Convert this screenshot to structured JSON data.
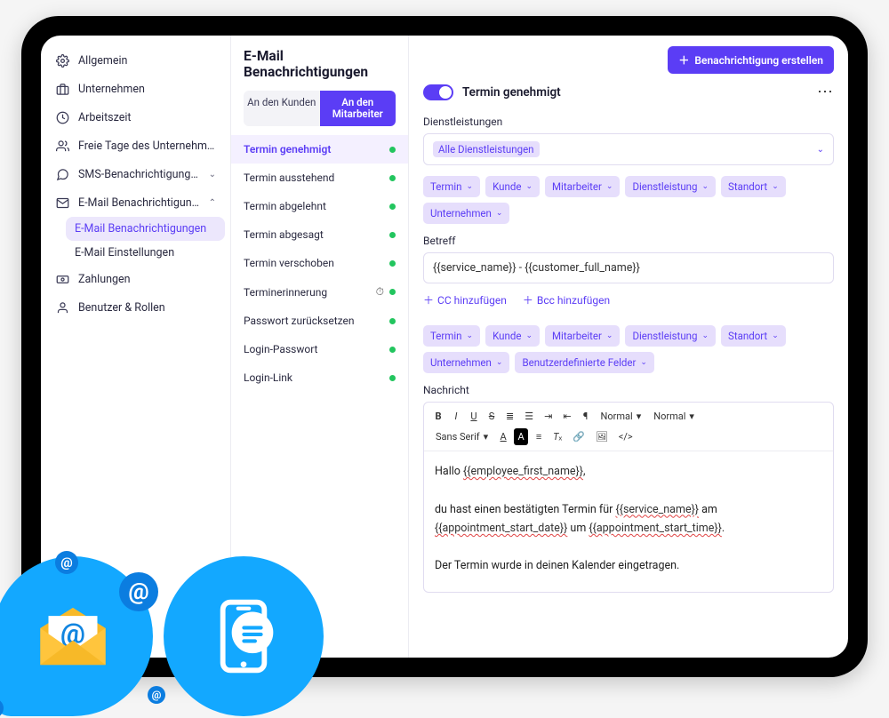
{
  "sidebar": {
    "items": [
      {
        "label": "Allgemein"
      },
      {
        "label": "Unternehmen"
      },
      {
        "label": "Arbeitszeit"
      },
      {
        "label": "Freie Tage des Unternehmens"
      },
      {
        "label": "SMS-Benachrichtigungen"
      },
      {
        "label": "E-Mail Benachrichtigungen"
      },
      {
        "label": "Zahlungen"
      },
      {
        "label": "Benutzer & Rollen"
      }
    ],
    "email_sub": [
      {
        "label": "E-Mail Benachrichtigungen"
      },
      {
        "label": "E-Mail Einstellungen"
      }
    ]
  },
  "templates": {
    "title": "E-Mail Benachrichtigungen",
    "tabs": {
      "customer": "An den Kunden",
      "employee": "An den Mitarbeiter"
    },
    "list": [
      {
        "label": "Termin genehmigt"
      },
      {
        "label": "Termin ausstehend"
      },
      {
        "label": "Termin abgelehnt"
      },
      {
        "label": "Termin abgesagt"
      },
      {
        "label": "Termin verschoben"
      },
      {
        "label": "Terminerinnerung"
      },
      {
        "label": "Passwort zurücksetzen"
      },
      {
        "label": "Login-Passwort"
      },
      {
        "label": "Login-Link"
      }
    ]
  },
  "main": {
    "create_btn": "Benachrichtigung erstellen",
    "switch_label": "Termin genehmigt",
    "services_label": "Dienstleistungen",
    "services_value": "Alle Dienstleistungen",
    "chips1": [
      "Termin",
      "Kunde",
      "Mitarbeiter",
      "Dienstleistung",
      "Standort",
      "Unternehmen"
    ],
    "subject_label": "Betreff",
    "subject_value": "{{service_name}} - {{customer_full_name}}",
    "add_cc": "CC hinzufügen",
    "add_bcc": "Bcc hinzufügen",
    "chips2": [
      "Termin",
      "Kunde",
      "Mitarbeiter",
      "Dienstleistung",
      "Standort",
      "Unternehmen",
      "Benutzerdefinierte Felder"
    ],
    "message_label": "Nachricht",
    "toolbar": {
      "font": "Sans Serif",
      "normal1": "Normal",
      "normal2": "Normal"
    },
    "body_lines": {
      "l1a": "Hallo ",
      "l1b": "{{employee_first_name}}",
      "l1c": ",",
      "l2a": "du hast einen bestätigten Termin für ",
      "l2b": "{{service_name}}",
      "l2c": " am",
      "l3a": "{{appointment_start_date}}",
      "l3b": " um ",
      "l3c": "{{appointment_start_time}}",
      "l3d": ".",
      "l4": "Der Termin wurde in deinen Kalender eingetragen."
    }
  }
}
